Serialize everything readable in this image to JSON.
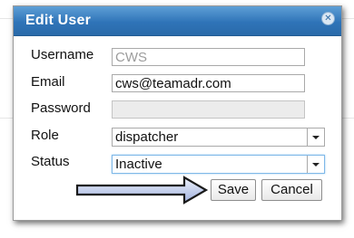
{
  "dialog": {
    "title": "Edit User",
    "close_icon": "close-circle-icon"
  },
  "form": {
    "username": {
      "label": "Username",
      "value": "CWS"
    },
    "email": {
      "label": "Email",
      "value": "cws@teamadr.com"
    },
    "password": {
      "label": "Password",
      "value": ""
    },
    "role": {
      "label": "Role",
      "value": "dispatcher"
    },
    "status": {
      "label": "Status",
      "value": "Inactive"
    }
  },
  "buttons": {
    "save": "Save",
    "cancel": "Cancel"
  },
  "annotation": {
    "icon": "arrow-right-icon",
    "fill_color": "#b9c7ea",
    "stroke_color": "#1a1a1a"
  },
  "colors": {
    "titlebar": "#2f74b8",
    "title_text": "#ffffff"
  }
}
